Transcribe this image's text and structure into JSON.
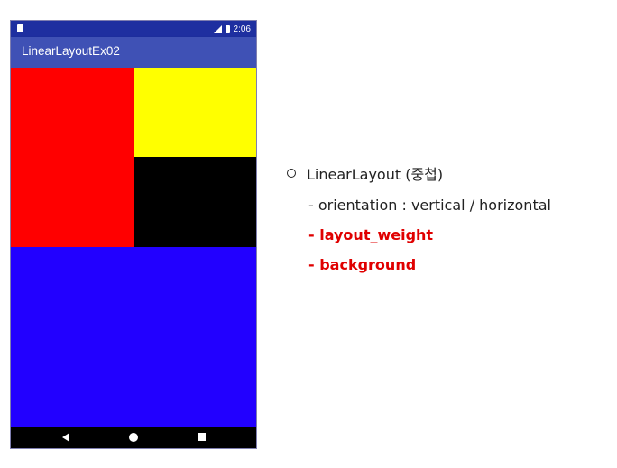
{
  "status_bar": {
    "time": "2:06",
    "icons": [
      "notification-icon",
      "signal-icon",
      "battery-icon"
    ]
  },
  "app_bar": {
    "title": "LinearLayoutEx02"
  },
  "content": {
    "blocks": [
      {
        "name": "red-block",
        "color": "#ff0000"
      },
      {
        "name": "yellow-block",
        "color": "#ffff00"
      },
      {
        "name": "black-block",
        "color": "#000000"
      },
      {
        "name": "blue-block",
        "color": "#2200ff"
      }
    ]
  },
  "nav_bar": {
    "icons": [
      "back-icon",
      "home-icon",
      "recents-icon"
    ]
  },
  "notes": {
    "heading": "LinearLayout (중첩)",
    "items": [
      {
        "text": "- orientation : vertical / horizontal",
        "highlight": false
      },
      {
        "text": "- layout_weight",
        "highlight": true,
        "color": "#e00000"
      },
      {
        "text": "- background",
        "highlight": true,
        "color": "#e00000"
      }
    ]
  }
}
